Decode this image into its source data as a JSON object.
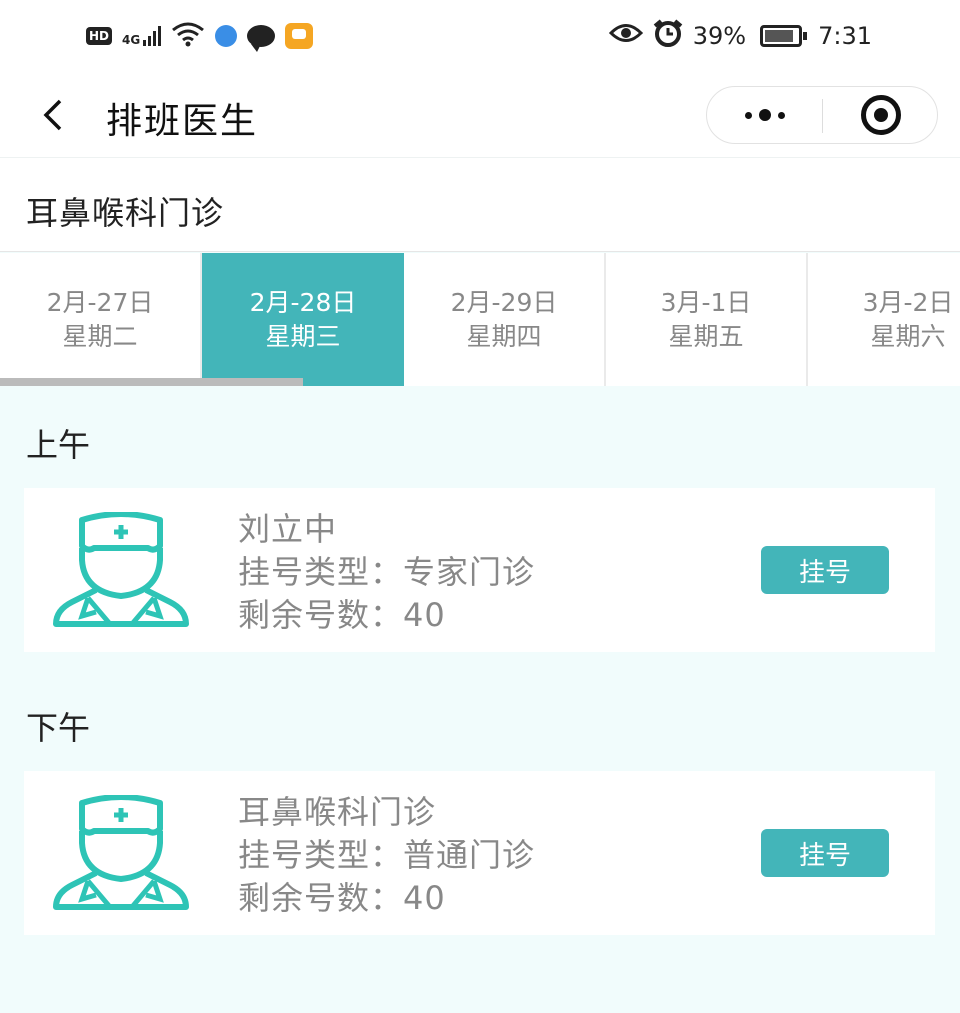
{
  "status_bar": {
    "left_icons": [
      "hd-icon",
      "signal-4g-icon",
      "wifi-icon",
      "app-blue-icon",
      "chat-icon",
      "app-orange-icon"
    ],
    "network_label": "4G",
    "hd_label": "HD",
    "battery": "39%",
    "time": "7:31"
  },
  "nav": {
    "title": "排班医生"
  },
  "department": "耳鼻喉科门诊",
  "date_tabs": [
    {
      "date": "2月-27日",
      "weekday": "星期二"
    },
    {
      "date": "2月-28日",
      "weekday": "星期三"
    },
    {
      "date": "2月-29日",
      "weekday": "星期四"
    },
    {
      "date": "3月-1日",
      "weekday": "星期五"
    },
    {
      "date": "3月-2日",
      "weekday": "星期六"
    }
  ],
  "selected_tab_index": 1,
  "morning": {
    "title": "上午",
    "doctor": {
      "name": "刘立中",
      "type_line": "挂号类型：专家门诊",
      "remaining_line": "剩余号数：40",
      "button": "挂号"
    }
  },
  "afternoon": {
    "title": "下午",
    "doctor": {
      "name": "耳鼻喉科门诊",
      "type_line": "挂号类型：普通门诊",
      "remaining_line": "剩余号数：40",
      "button": "挂号"
    }
  },
  "colors": {
    "accent": "#43b5b9",
    "page_background": "#f1fcfc"
  }
}
